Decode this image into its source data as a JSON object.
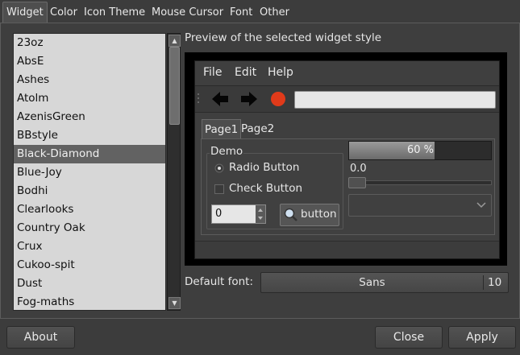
{
  "tabs": [
    "Widget",
    "Color",
    "Icon Theme",
    "Mouse Cursor",
    "Font",
    "Other"
  ],
  "theme_list": {
    "items": [
      "23oz",
      "AbsE",
      "Ashes",
      "Atolm",
      "AzenisGreen",
      "BBstyle",
      "Black-Diamond",
      "Blue-Joy",
      "Bodhi",
      "Clearlooks",
      "Country Oak",
      "Crux",
      "Cukoo-spit",
      "Dust",
      "Fog-maths"
    ],
    "selected": "Black-Diamond"
  },
  "preview": {
    "label": "Preview of the selected widget style",
    "menu": [
      "File",
      "Edit",
      "Help"
    ],
    "tabs": [
      "Page1",
      "Page2"
    ],
    "group_title": "Demo",
    "radio_label": "Radio Button",
    "check_label": "Check Button",
    "spin_value": "0",
    "button_label": "button",
    "progress_text": "60 %",
    "progress": 0.6,
    "scale_value": "0.0"
  },
  "font": {
    "label": "Default font:",
    "name": "Sans",
    "size": "10"
  },
  "buttons": {
    "about": "About",
    "close": "Close",
    "apply": "Apply"
  },
  "colors": {
    "accent_record": "#e03a1a"
  }
}
